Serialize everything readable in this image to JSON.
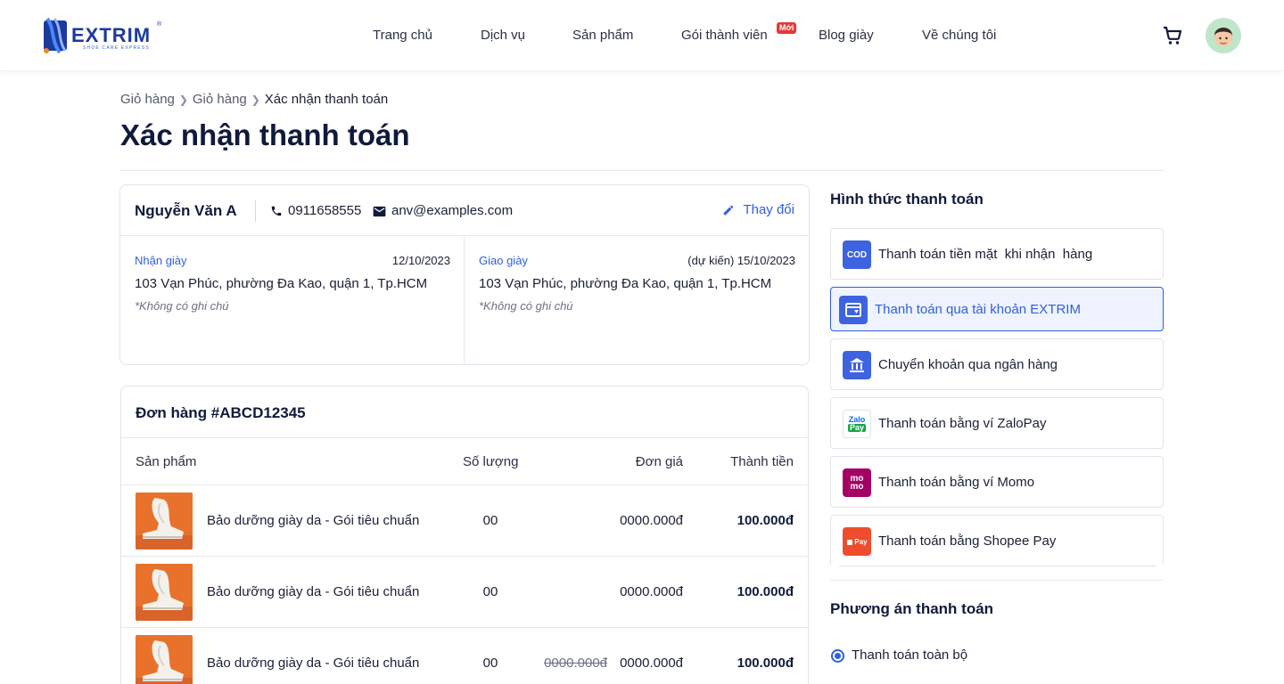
{
  "brand": {
    "name": "EXTRIM",
    "tagline": "SHOE CARE EXPRESS",
    "reg": "®"
  },
  "nav": {
    "items": [
      "Trang chủ",
      "Dịch vụ",
      "Sản phẩm",
      "Gói thành viên",
      "Blog giày",
      "Về chúng tôi"
    ],
    "new_badge": "Mới"
  },
  "breadcrumb": [
    "Giỏ hàng",
    "Giỏ hàng",
    "Xác nhận thanh toán"
  ],
  "page_title": "Xác nhận thanh toán",
  "customer": {
    "name": "Nguyễn Văn A",
    "phone": "0911658555",
    "email": "anv@examples.com",
    "edit_label": "Thay đổi",
    "pickup": {
      "label": "Nhận giày",
      "date": "12/10/2023",
      "address": "103 Vạn Phúc, phường Đa Kao, quận 1, Tp.HCM",
      "note": "*Không có ghi chú"
    },
    "delivery": {
      "label": "Giao giày",
      "date": "(dự kiến) 15/10/2023",
      "address": "103 Vạn Phúc, phường Đa Kao, quận 1, Tp.HCM",
      "note": "*Không có ghi chú"
    }
  },
  "order": {
    "title": "Đơn hàng #ABCD12345",
    "columns": [
      "Sản phẩm",
      "Số lượng",
      "Đơn giá",
      "Thành tiền"
    ],
    "rows": [
      {
        "name": "Bảo dưỡng giày da - Gói tiêu chuẩn",
        "qty": "00",
        "old_price": "",
        "unit_price": "0000.000đ",
        "total": "100.000đ"
      },
      {
        "name": "Bảo dưỡng giày da - Gói tiêu chuẩn",
        "qty": "00",
        "old_price": "",
        "unit_price": "0000.000đ",
        "total": "100.000đ"
      },
      {
        "name": "Bảo dưỡng giày da - Gói tiêu chuẩn",
        "qty": "00",
        "old_price": "0000.000đ",
        "unit_price": "0000.000đ",
        "total": "100.000đ"
      }
    ]
  },
  "payment": {
    "title": "Hình thức thanh toán",
    "methods": [
      {
        "label": "Thanh toán tiền mặt  khi nhận  hàng",
        "icon": "cod-icon",
        "icon_text": "COD",
        "color": "#3d63e0",
        "selected": false
      },
      {
        "label": "Thanh toán qua tài khoản EXTRIM",
        "icon": "wallet-icon",
        "icon_text": "",
        "color": "#3d63e0",
        "selected": true
      },
      {
        "label": "Chuyển khoản qua ngân hàng",
        "icon": "bank-icon",
        "icon_text": "",
        "color": "#3d63e0",
        "selected": false
      },
      {
        "label": "Thanh toán bằng ví ZaloPay",
        "icon": "zalopay-icon",
        "icon_text": "Zalo Pay",
        "color": "#1aa34a",
        "selected": false
      },
      {
        "label": "Thanh toán bằng ví Momo",
        "icon": "momo-icon",
        "icon_text": "mo mo",
        "color": "#a50064",
        "selected": false
      },
      {
        "label": "Thanh toán bằng Shopee Pay",
        "icon": "shopeepay-icon",
        "icon_text": "Pay",
        "color": "#ee4d2d",
        "selected": false
      }
    ]
  },
  "plan": {
    "title": "Phương án thanh toán",
    "option": "Thanh toán toàn bộ"
  },
  "colors": {
    "primary": "#2f5fe0",
    "title": "#101a3c",
    "border": "#e1e4ec"
  }
}
